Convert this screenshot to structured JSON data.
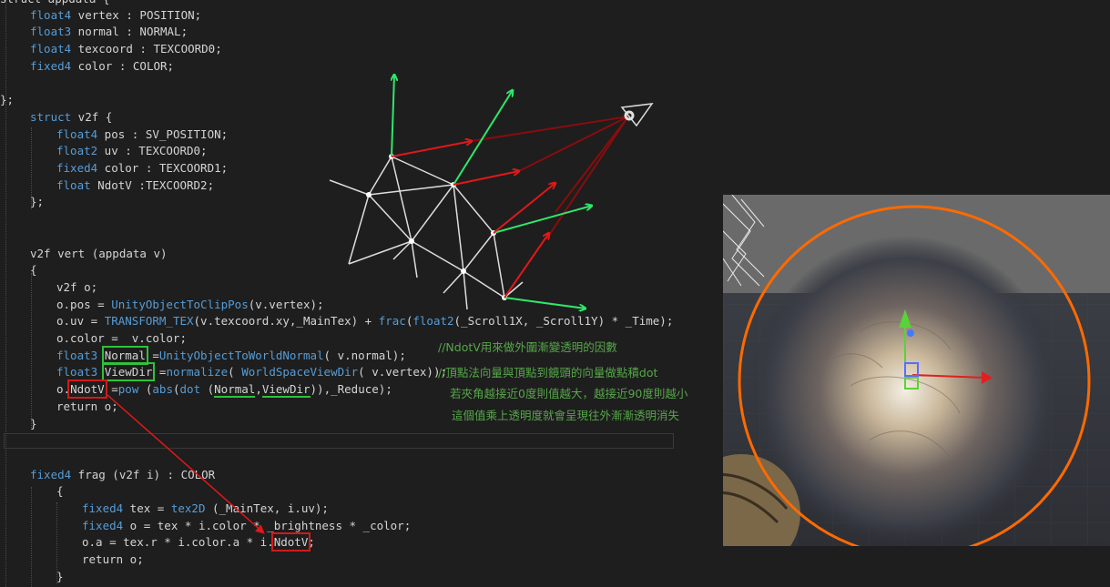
{
  "code": {
    "l1": "struct appdata {",
    "l2_type": "float4",
    "l2_rest": " vertex : POSITION;",
    "l3_type": "float3",
    "l3_rest": " normal : NORMAL;",
    "l4_type": "float4",
    "l4_rest": " texcoord : TEXCOORD0;",
    "l5_type": "fixed4",
    "l5_rest": " color : COLOR;",
    "l7": "};",
    "l8_kw": "struct",
    "l8_rest": " v2f {",
    "l9_type": "float4",
    "l9_rest": " pos : SV_POSITION;",
    "l10_type": "float2",
    "l10_rest": " uv : TEXCOORD0;",
    "l11_type": "fixed4",
    "l11_rest": " color : TEXCOORD1;",
    "l12_type": "float",
    "l12_rest": " NdotV :TEXCOORD2;",
    "l13": "};",
    "l16": "v2f vert (appdata v)",
    "l17": "{",
    "l18": "v2f o;",
    "l19_a": "o.pos = ",
    "l19_fn": "UnityObjectToClipPos",
    "l19_b": "(v.vertex);",
    "l20_a": "o.uv = ",
    "l20_fn": "TRANSFORM_TEX",
    "l20_b": "(v.texcoord.xy,_MainTex) + ",
    "l20_fn2": "frac",
    "l20_c": "(",
    "l20_ty": "float2",
    "l20_d": "(_Scroll1X, _Scroll1Y) * _Time);",
    "l21": "o.color =  v.color;",
    "l22_type": "float3",
    "l22_box": "Normal",
    "l22_a": " =",
    "l22_fn": "UnityObjectToWorldNormal",
    "l22_b": "( v.normal);",
    "l23_type": "float3",
    "l23_box": "ViewDir",
    "l23_a": " =",
    "l23_fn": "normalize",
    "l23_b": "( ",
    "l23_fn2": "WorldSpaceViewDir",
    "l23_c": "( v.vertex));",
    "l24_a": "o.",
    "l24_box": "NdotV",
    "l24_b": " =",
    "l24_fn": "pow",
    "l24_c": " (",
    "l24_fn2": "abs",
    "l24_d": "(",
    "l24_fn3": "dot",
    "l24_e": " (",
    "l24_u1": "Normal",
    "l24_f": ",",
    "l24_u2": "ViewDir",
    "l24_g": ")),_Reduce);",
    "l25": "return o;",
    "l26": "}",
    "l29_type": "fixed4",
    "l29_rest": " frag (v2f i) : COLOR",
    "l30": "{",
    "l31_type": "fixed4",
    "l31_a": " tex = ",
    "l31_fn": "tex2D",
    "l31_b": " (_MainTex, i.uv);",
    "l32_type": "fixed4",
    "l32_a": " o = tex * i.color * _brightness * _color;",
    "l33_a": "o.a = tex.r * i.color.a * i.",
    "l33_box": "NdotV",
    "l33_b": ";",
    "l34": "return o;",
    "l35": "}"
  },
  "comments": {
    "c1": "//NdotV用來做外圍漸變透明的因數",
    "c2": "//頂點法向量與頂點到鏡頭的向量做點積dot",
    "c3": "若夾角越接近0度則值越大，越接近90度則越小",
    "c4": "這個值乘上透明度就會呈現往外漸漸透明消失"
  },
  "colors": {
    "normal_arrow": "#2ee86a",
    "view_arrow": "#e01818",
    "dark_view_line": "#8a0c0c",
    "mesh_line": "#dddddd",
    "orange_circle": "#ff6a00"
  },
  "icons": {
    "camera": "eye-camera-icon"
  }
}
